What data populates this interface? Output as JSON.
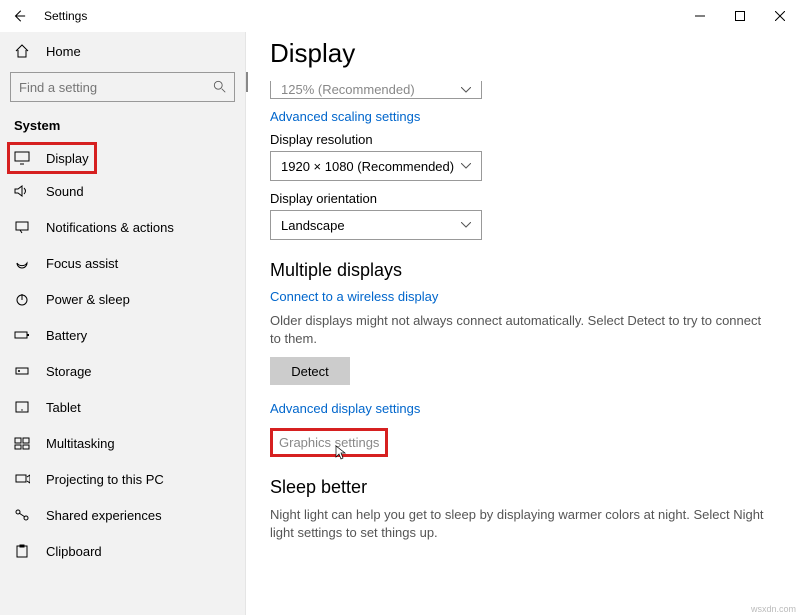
{
  "window": {
    "title": "Settings"
  },
  "sidebar": {
    "home": "Home",
    "search_placeholder": "Find a setting",
    "group": "System",
    "items": [
      "Display",
      "Sound",
      "Notifications & actions",
      "Focus assist",
      "Power & sleep",
      "Battery",
      "Storage",
      "Tablet",
      "Multitasking",
      "Projecting to this PC",
      "Shared experiences",
      "Clipboard"
    ]
  },
  "content": {
    "title": "Display",
    "scale_select": "125% (Recommended)",
    "link_adv_scaling": "Advanced scaling settings",
    "label_res": "Display resolution",
    "res_select": "1920 × 1080 (Recommended)",
    "label_orient": "Display orientation",
    "orient_select": "Landscape",
    "heading_multi": "Multiple displays",
    "link_wireless": "Connect to a wireless display",
    "text_older": "Older displays might not always connect automatically. Select Detect to try to connect to them.",
    "btn_detect": "Detect",
    "link_adv_display": "Advanced display settings",
    "link_graphics": "Graphics settings",
    "heading_sleep": "Sleep better",
    "text_sleep": "Night light can help you get to sleep by displaying warmer colors at night. Select Night light settings to set things up."
  },
  "watermark": "wsxdn.com"
}
